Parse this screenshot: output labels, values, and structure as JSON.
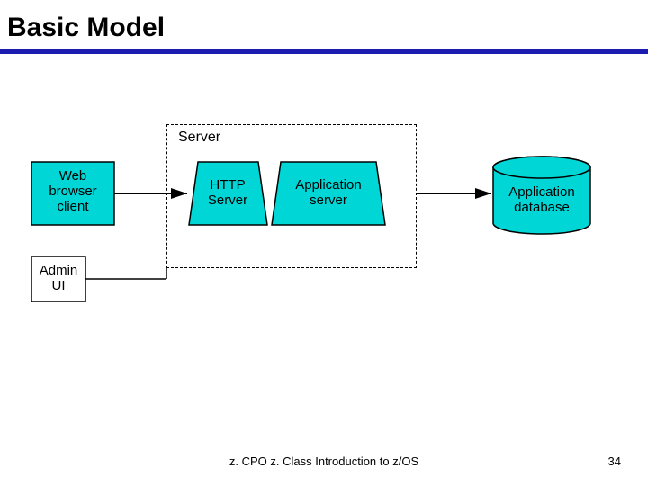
{
  "title": "Basic Model",
  "server_group_label": "Server",
  "nodes": {
    "web_client": "Web\nbrowser\nclient",
    "admin_ui": "Admin\nUI",
    "http_server": "HTTP\nServer",
    "app_server": "Application\nserver",
    "app_db": "Application\ndatabase"
  },
  "footer": "z. CPO z. Class Introduction to z/OS",
  "page_number": "34",
  "colors": {
    "fill": "#00d6d6",
    "stroke": "#000"
  }
}
